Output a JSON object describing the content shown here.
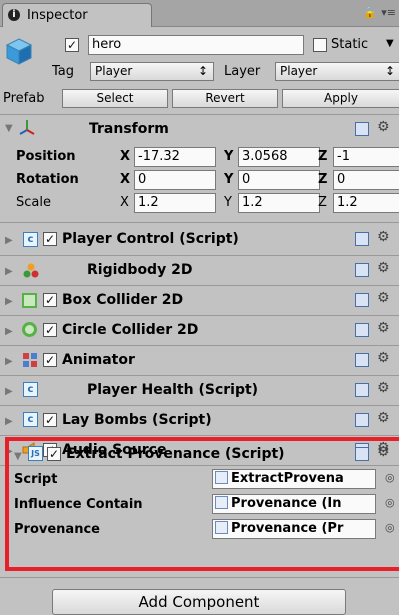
{
  "tab": {
    "label": "Inspector"
  },
  "object": {
    "name": "hero",
    "active": true,
    "static_label": "Static",
    "static": false,
    "tag_label": "Tag",
    "tag_value": "Player",
    "layer_label": "Layer",
    "layer_value": "Player"
  },
  "prefab": {
    "label": "Prefab",
    "select": "Select",
    "revert": "Revert",
    "apply": "Apply"
  },
  "transform": {
    "title": "Transform",
    "rows": [
      {
        "label": "Position",
        "x": "-17.32",
        "y": "3.0568",
        "z": "-1"
      },
      {
        "label": "Rotation",
        "x": "0",
        "y": "0",
        "z": "0"
      },
      {
        "label": "Scale",
        "x": "1.2",
        "y": "1.2",
        "z": "1.2"
      }
    ],
    "axis_x": "X",
    "axis_y": "Y",
    "axis_z": "Z"
  },
  "components": [
    {
      "name": "Player Control (Script)",
      "icon": "script-icon",
      "enabled": true
    },
    {
      "name": "Rigidbody 2D",
      "icon": "rigidbody-icon",
      "enabled": null
    },
    {
      "name": "Box Collider 2D",
      "icon": "box-collider-icon",
      "enabled": true
    },
    {
      "name": "Circle Collider 2D",
      "icon": "circle-collider-icon",
      "enabled": true
    },
    {
      "name": "Animator",
      "icon": "animator-icon",
      "enabled": true
    },
    {
      "name": "Player Health (Script)",
      "icon": "script-icon",
      "enabled": null
    },
    {
      "name": "Lay Bombs (Script)",
      "icon": "script-icon",
      "enabled": true
    },
    {
      "name": "Audio Source",
      "icon": "audio-icon",
      "enabled": true
    }
  ],
  "extract": {
    "title": "Extract Provenance (Script)",
    "fields": [
      {
        "label": "Script",
        "value": "ExtractProvena"
      },
      {
        "label": "Influence Contain",
        "value": "Provenance (In"
      },
      {
        "label": "Provenance",
        "value": "Provenance (Pr"
      }
    ]
  },
  "add_component": "Add Component",
  "highlight_color": "#e8202a"
}
